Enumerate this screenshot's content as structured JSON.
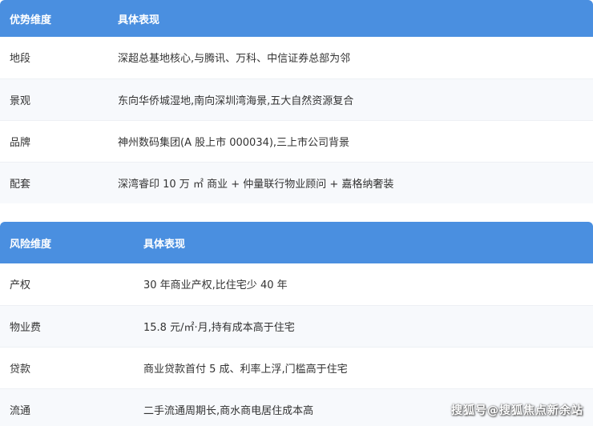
{
  "advantages": {
    "headers": [
      "优势维度",
      "具体表现"
    ],
    "rows": [
      [
        "地段",
        "深超总基地核心,与腾讯、万科、中信证券总部为邻"
      ],
      [
        "景观",
        "东向华侨城湿地,南向深圳湾海景,五大自然资源复合"
      ],
      [
        "品牌",
        "神州数码集团(A 股上市 000034),三上市公司背景"
      ],
      [
        "配套",
        "深湾睿印 10 万 ㎡ 商业 + 仲量联行物业顾问 + 嘉格纳奢装"
      ]
    ]
  },
  "risks": {
    "headers": [
      "风险维度",
      "具体表现"
    ],
    "rows": [
      [
        "产权",
        "30 年商业产权,比住宅少 40 年"
      ],
      [
        "物业费",
        "15.8 元/㎡·月,持有成本高于住宅"
      ],
      [
        "贷款",
        "商业贷款首付 5 成、利率上浮,门槛高于住宅"
      ],
      [
        "流通",
        "二手流通周期长,商水商电居住成本高"
      ]
    ]
  },
  "watermark": "搜狐号@搜狐焦点新余站",
  "colors": {
    "header_bg": "#4a8fe0",
    "header_text": "#ffffff",
    "row_alt_bg": "#f7f9fc",
    "body_text": "#333333"
  }
}
